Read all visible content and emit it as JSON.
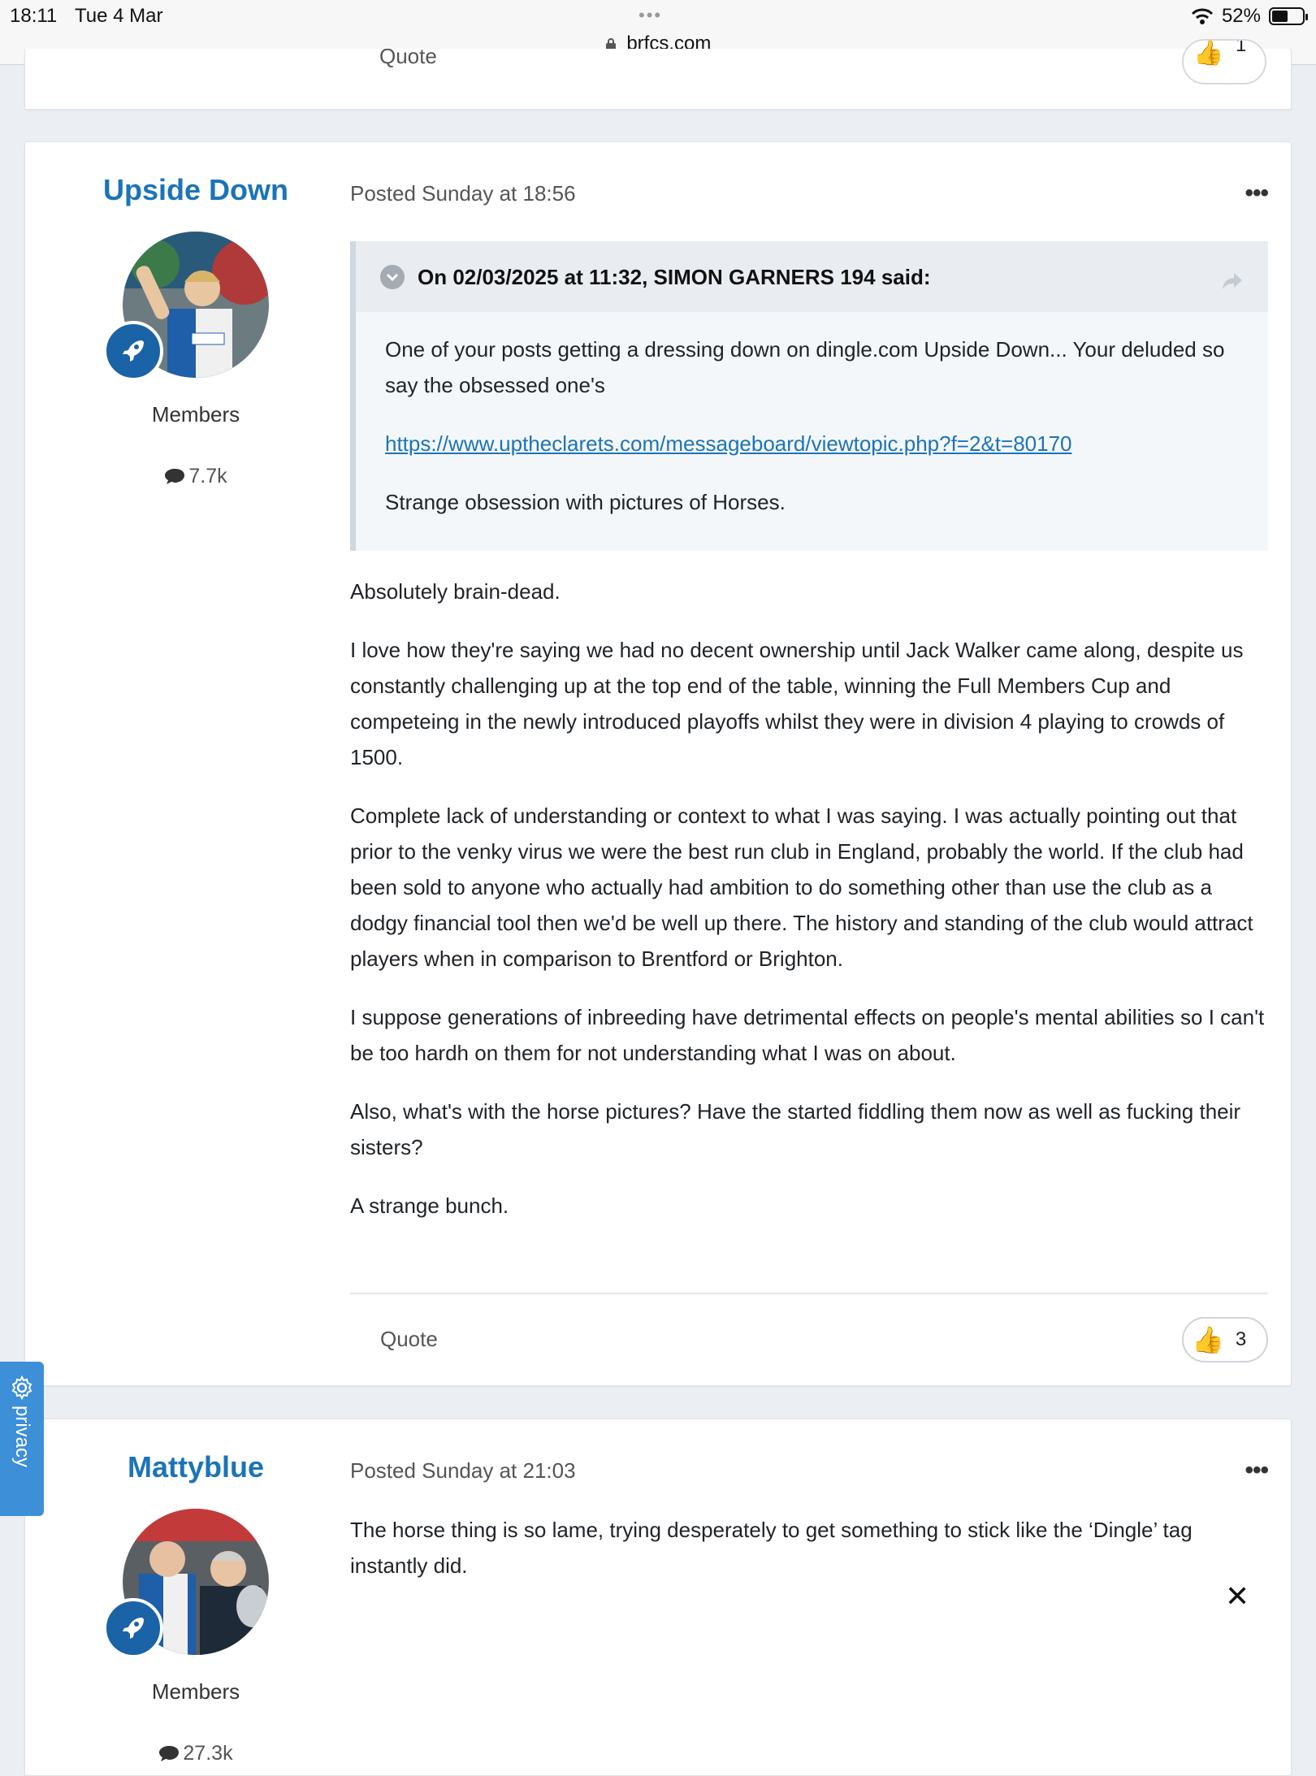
{
  "status_bar": {
    "time": "18:11",
    "date": "Tue 4 Mar",
    "dots": "•••",
    "url": "brfcs.com",
    "battery": "52%"
  },
  "prev_post": {
    "quote_label": "Quote",
    "reaction_count": "1"
  },
  "posts": [
    {
      "author": "Upside Down",
      "group": "Members",
      "post_count": "7.7k",
      "posted": "Posted Sunday at 18:56",
      "menu": "•••",
      "quote": {
        "header": "On 02/03/2025 at 11:32, SIMON GARNERS 194 said:",
        "paragraphs": [
          "One of your posts getting a dressing down on dingle.com Upside Down... Your deluded so say the obsessed one's"
        ],
        "link": "https://www.uptheclarets.com/messageboard/viewtopic.php?f=2&t=80170",
        "closing": "Strange obsession with pictures of Horses."
      },
      "paragraphs": [
        "Absolutely brain-dead.",
        "I love how they're saying we had no decent ownership until Jack Walker came along, despite us constantly challenging up at the top end of the table, winning the Full Members Cup and competeing in the newly introduced playoffs whilst they were in division 4 playing to crowds of 1500.",
        "Complete lack of understanding or context to what I was saying. I was actually pointing out that prior to the venky virus we were the best run club in England, probably the world. If the club had been sold to anyone who actually had ambition to do something other than use the club as a dodgy financial tool then we'd be well up there. The history and standing of the club would attract players when in comparison to Brentford or Brighton.",
        "I suppose generations of inbreeding have detrimental effects on people's mental abilities so I can't be too hardh on them for not understanding what I was on about.",
        "Also, what's with the horse pictures? Have the started fiddling them now as well as fucking their sisters?",
        "A strange bunch."
      ],
      "quote_label": "Quote",
      "reaction_count": "3"
    },
    {
      "author": "Mattyblue",
      "group": "Members",
      "post_count": "27.3k",
      "posted": "Posted Sunday at 21:03",
      "menu": "•••",
      "paragraphs": [
        "The horse thing is so lame, trying desperately to get something to stick like the ‘Dingle’ tag instantly did."
      ]
    }
  ],
  "privacy_tab": {
    "label": "privacy"
  },
  "close_button": {
    "label": "✕"
  },
  "colors": {
    "author_blue": "#1b74b8",
    "badge_blue": "#1a63a6",
    "privacy_blue": "#3d8fd8",
    "page_bg": "#ebeef2"
  },
  "icons": [
    "lock-icon",
    "wifi-icon",
    "battery-icon",
    "rocket-icon",
    "speech-bubble-icon",
    "chevron-down-icon",
    "share-icon",
    "thumbs-up-icon",
    "gear-icon",
    "close-icon"
  ]
}
